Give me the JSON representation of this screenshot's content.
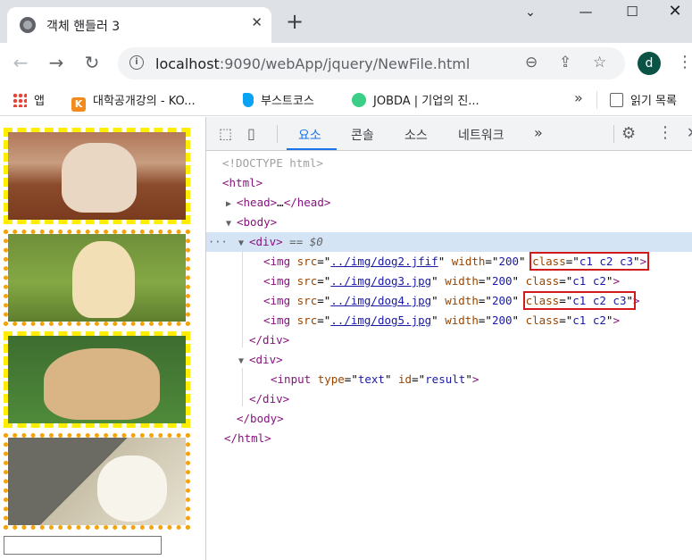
{
  "window": {
    "tab_title": "객체 핸들러 3",
    "close_glyph": "✕",
    "newtab_glyph": "+",
    "tabsearch_glyph": "⌄",
    "min_glyph": "—",
    "max_glyph": "☐",
    "winclose_glyph": "✕"
  },
  "toolbar": {
    "back_glyph": "←",
    "fwd_glyph": "→",
    "reload_glyph": "↻",
    "info_glyph": "i",
    "url_host": "localhost",
    "url_rest": ":9090/webApp/jquery/NewFile.html",
    "zoom_glyph": "⊖",
    "share_glyph": "⇪",
    "star_glyph": "☆",
    "avatar_letter": "d",
    "menu_glyph": "⋮"
  },
  "bookmarks": {
    "apps": "앱",
    "kocw_icon": "K",
    "kocw": "대학공개강의 - KO...",
    "boost": "부스트코스",
    "jobda": "JOBDA | 기업의 진...",
    "more": "»",
    "reading": "읽기 목록"
  },
  "devtools": {
    "tabs": [
      "요소",
      "콘솔",
      "소스",
      "네트워크"
    ],
    "more_tabs": "»",
    "gear": "⚙",
    "kebab": "⋮",
    "close": "✕",
    "dom": {
      "doctype": "<!DOCTYPE html>",
      "html_open": "<html>",
      "head": "<head>",
      "head_ellipsis": "…",
      "head_close": "</head>",
      "body_open": "<body>",
      "div_open": "<div>",
      "selected_marker": "== $0",
      "selected_dots": "···",
      "images": [
        {
          "src": "../img/dog2.jfif",
          "width": "200",
          "class": "c1 c2 c3"
        },
        {
          "src": "../img/dog3.jpg",
          "width": "200",
          "class": "c1 c2"
        },
        {
          "src": "../img/dog4.jpg",
          "width": "200",
          "class": "c1 c2 c3"
        },
        {
          "src": "../img/dog5.jpg",
          "width": "200",
          "class": "c1 c2"
        }
      ],
      "div_close": "</div>",
      "div2_open": "<div>",
      "input": {
        "type": "text",
        "id": "result"
      },
      "div2_close": "</div>",
      "body_close": "</body>",
      "html_close": "</html>"
    }
  },
  "colors": {
    "c2_border": "#f5a30b",
    "c3_border": "#ffee00",
    "highlight_box": "#d11a1a",
    "selected_row": "#d5e4f5"
  },
  "icons": {
    "favicon": "globe-icon",
    "inspect": "inspect-element-icon",
    "device": "device-toolbar-icon",
    "gear": "gear-icon"
  }
}
